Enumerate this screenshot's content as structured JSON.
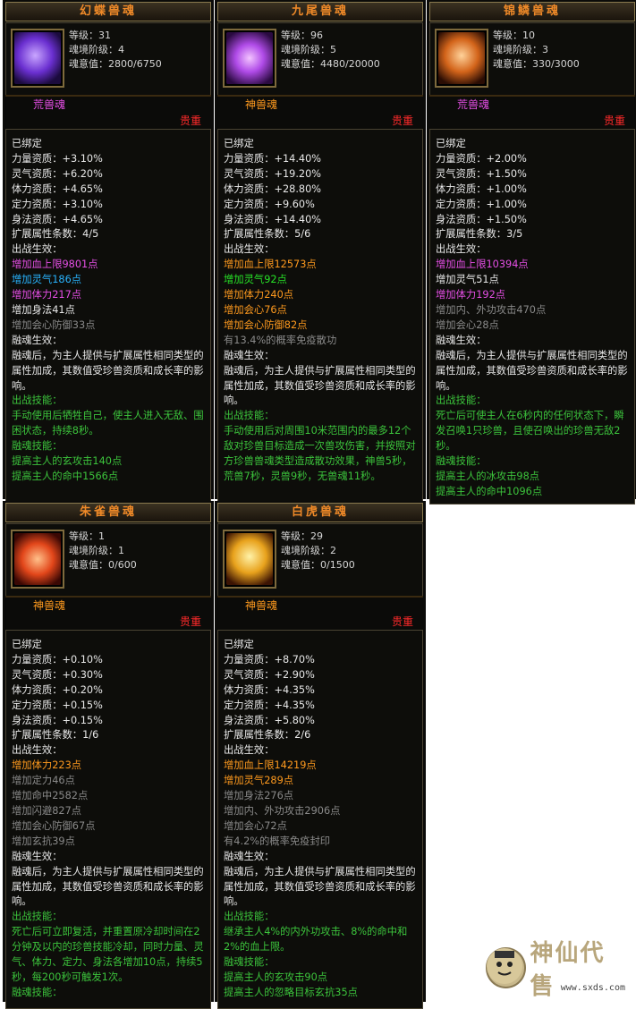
{
  "colors": {
    "title": "#f08a28",
    "rarity": "#ff2a2a",
    "white": "#e8e8e8",
    "gray": "#8a8a8a",
    "green": "#3cc43c",
    "purple": "#e64fe6",
    "cyan": "#29b4ff",
    "orange": "#ff9a1e"
  },
  "cards": [
    {
      "title": "幻蝶兽魂",
      "icon": "butterfly-soul-icon",
      "level": "等级：31",
      "stage": "魂境阶级：4",
      "will": "魂意值：2800/6750",
      "rank": "荒兽魂",
      "rank_color": "#e64fe6",
      "rarity": "贵重",
      "lines": [
        {
          "t": "已绑定",
          "c": "w"
        },
        {
          "t": "力量资质：+3.10%",
          "c": "w"
        },
        {
          "t": "灵气资质：+6.20%",
          "c": "w"
        },
        {
          "t": "体力资质：+4.65%",
          "c": "w"
        },
        {
          "t": "定力资质：+3.10%",
          "c": "w"
        },
        {
          "t": "身法资质：+4.65%",
          "c": "w"
        },
        {
          "t": "扩展属性条数：4/5",
          "c": "w"
        },
        {
          "t": "出战生效：",
          "c": "w"
        },
        {
          "t": "增加血上限9801点",
          "c": "pu"
        },
        {
          "t": "增加灵气186点",
          "c": "cy"
        },
        {
          "t": "增加体力217点",
          "c": "pu"
        },
        {
          "t": "增加身法41点",
          "c": "w"
        },
        {
          "t": "增加会心防御33点",
          "c": "g"
        },
        {
          "t": "融魂生效：",
          "c": "w"
        },
        {
          "t": "融魂后，为主人提供与扩展属性相同类型的属性加成，其数值受珍兽资质和成长率的影响。",
          "c": "w",
          "wrap": true
        },
        {
          "t": "出战技能：",
          "c": "gr"
        },
        {
          "t": "手动使用后牺牲自己，使主人进入无敌、围困状态，持续8秒。",
          "c": "gr",
          "wrap": true
        },
        {
          "t": "融魂技能：",
          "c": "gr"
        },
        {
          "t": "提高主人的玄攻击140点",
          "c": "gr"
        },
        {
          "t": "提高主人的命中1566点",
          "c": "gr"
        }
      ]
    },
    {
      "title": "九尾兽魂",
      "icon": "ninetail-soul-icon",
      "level": "等级：96",
      "stage": "魂境阶级：5",
      "will": "魂意值：4480/20000",
      "rank": "神兽魂",
      "rank_color": "#ff9a1e",
      "rarity": "贵重",
      "lines": [
        {
          "t": "已绑定",
          "c": "w"
        },
        {
          "t": "力量资质：+14.40%",
          "c": "w"
        },
        {
          "t": "灵气资质：+19.20%",
          "c": "w"
        },
        {
          "t": "体力资质：+28.80%",
          "c": "w"
        },
        {
          "t": "定力资质：+9.60%",
          "c": "w"
        },
        {
          "t": "身法资质：+14.40%",
          "c": "w"
        },
        {
          "t": "扩展属性条数：5/6",
          "c": "w"
        },
        {
          "t": "出战生效：",
          "c": "w"
        },
        {
          "t": "增加血上限12573点",
          "c": "or"
        },
        {
          "t": "增加灵气92点",
          "c": "gl"
        },
        {
          "t": "增加体力240点",
          "c": "or"
        },
        {
          "t": "增加会心76点",
          "c": "or"
        },
        {
          "t": "增加会心防御82点",
          "c": "or"
        },
        {
          "t": "有13.4%的概率免疫散功",
          "c": "g"
        },
        {
          "t": "融魂生效：",
          "c": "w"
        },
        {
          "t": "融魂后，为主人提供与扩展属性相同类型的属性加成，其数值受珍兽资质和成长率的影响。",
          "c": "w",
          "wrap": true
        },
        {
          "t": "出战技能：",
          "c": "gr"
        },
        {
          "t": "手动使用后对周围10米范围内的最多12个敌对珍兽目标造成一次兽攻伤害，并按照对方珍兽兽魂类型造成散功效果，神兽5秒，荒兽7秒，灵兽9秒，无兽魂11秒。",
          "c": "gr",
          "wrap": true
        }
      ]
    },
    {
      "title": "锦鳞兽魂",
      "icon": "brocade-scale-soul-icon",
      "level": "等级：10",
      "stage": "魂境阶级：3",
      "will": "魂意值：330/3000",
      "rank": "荒兽魂",
      "rank_color": "#e64fe6",
      "rarity": "贵重",
      "lines": [
        {
          "t": "已绑定",
          "c": "w"
        },
        {
          "t": "力量资质：+2.00%",
          "c": "w"
        },
        {
          "t": "灵气资质：+1.50%",
          "c": "w"
        },
        {
          "t": "体力资质：+1.00%",
          "c": "w"
        },
        {
          "t": "定力资质：+1.00%",
          "c": "w"
        },
        {
          "t": "身法资质：+1.50%",
          "c": "w"
        },
        {
          "t": "扩展属性条数：3/5",
          "c": "w"
        },
        {
          "t": "出战生效：",
          "c": "w"
        },
        {
          "t": "增加血上限10394点",
          "c": "pu"
        },
        {
          "t": "增加灵气51点",
          "c": "w"
        },
        {
          "t": "增加体力192点",
          "c": "pu"
        },
        {
          "t": "增加内、外功攻击470点",
          "c": "g"
        },
        {
          "t": "增加会心28点",
          "c": "g"
        },
        {
          "t": "融魂生效：",
          "c": "w"
        },
        {
          "t": "融魂后，为主人提供与扩展属性相同类型的属性加成，其数值受珍兽资质和成长率的影响。",
          "c": "w",
          "wrap": true
        },
        {
          "t": "出战技能：",
          "c": "gr"
        },
        {
          "t": "死亡后可使主人在6秒内的任何状态下，瞬发召唤1只珍兽，且使召唤出的珍兽无敌2秒。",
          "c": "gr",
          "wrap": true
        },
        {
          "t": "融魂技能：",
          "c": "gr"
        },
        {
          "t": "提高主人的冰攻击98点",
          "c": "gr"
        },
        {
          "t": "提高主人的命中1096点",
          "c": "gr"
        }
      ]
    },
    {
      "title": "朱雀兽魂",
      "icon": "vermilion-bird-soul-icon",
      "level": "等级：1",
      "stage": "魂境阶级：1",
      "will": "魂意值：0/600",
      "rank": "神兽魂",
      "rank_color": "#ff9a1e",
      "rarity": "贵重",
      "lines": [
        {
          "t": "已绑定",
          "c": "w"
        },
        {
          "t": "力量资质：+0.10%",
          "c": "w"
        },
        {
          "t": "灵气资质：+0.30%",
          "c": "w"
        },
        {
          "t": "体力资质：+0.20%",
          "c": "w"
        },
        {
          "t": "定力资质：+0.15%",
          "c": "w"
        },
        {
          "t": "身法资质：+0.15%",
          "c": "w"
        },
        {
          "t": "扩展属性条数：1/6",
          "c": "w"
        },
        {
          "t": "出战生效：",
          "c": "w"
        },
        {
          "t": "增加体力223点",
          "c": "or"
        },
        {
          "t": "增加定力46点",
          "c": "g"
        },
        {
          "t": "增加命中2582点",
          "c": "g"
        },
        {
          "t": "增加闪避827点",
          "c": "g"
        },
        {
          "t": "增加会心防御67点",
          "c": "g"
        },
        {
          "t": "增加玄抗39点",
          "c": "g"
        },
        {
          "t": "融魂生效：",
          "c": "w"
        },
        {
          "t": "融魂后，为主人提供与扩展属性相同类型的属性加成，其数值受珍兽资质和成长率的影响。",
          "c": "w",
          "wrap": true
        },
        {
          "t": "出战技能：",
          "c": "gr"
        },
        {
          "t": "死亡后可立即复活，并重置原冷却时间在2分钟及以内的珍兽技能冷却，同时力量、灵气、体力、定力、身法各增加10点，持续5秒，每200秒可触发1次。",
          "c": "gr",
          "wrap": true
        },
        {
          "t": "融魂技能：",
          "c": "gr"
        }
      ]
    },
    {
      "title": "白虎兽魂",
      "icon": "white-tiger-soul-icon",
      "level": "等级：29",
      "stage": "魂境阶级：2",
      "will": "魂意值：0/1500",
      "rank": "神兽魂",
      "rank_color": "#ff9a1e",
      "rarity": "贵重",
      "lines": [
        {
          "t": "已绑定",
          "c": "w"
        },
        {
          "t": "力量资质：+8.70%",
          "c": "w"
        },
        {
          "t": "灵气资质：+2.90%",
          "c": "w"
        },
        {
          "t": "体力资质：+4.35%",
          "c": "w"
        },
        {
          "t": "定力资质：+4.35%",
          "c": "w"
        },
        {
          "t": "身法资质：+5.80%",
          "c": "w"
        },
        {
          "t": "扩展属性条数：2/6",
          "c": "w"
        },
        {
          "t": "出战生效：",
          "c": "w"
        },
        {
          "t": "增加血上限14219点",
          "c": "or"
        },
        {
          "t": "增加灵气289点",
          "c": "or"
        },
        {
          "t": "增加身法276点",
          "c": "g"
        },
        {
          "t": "增加内、外功攻击2906点",
          "c": "g"
        },
        {
          "t": "增加会心72点",
          "c": "g"
        },
        {
          "t": "有4.2%的概率免疫封印",
          "c": "g"
        },
        {
          "t": "融魂生效：",
          "c": "w"
        },
        {
          "t": "融魂后，为主人提供与扩展属性相同类型的属性加成，其数值受珍兽资质和成长率的影响。",
          "c": "w",
          "wrap": true
        },
        {
          "t": "出战技能：",
          "c": "gr"
        },
        {
          "t": "继承主人4%的内外功攻击、8%的命中和2%的血上限。",
          "c": "gr",
          "wrap": true
        },
        {
          "t": "融魂技能：",
          "c": "gr"
        },
        {
          "t": "提高主人的玄攻击90点",
          "c": "gr"
        },
        {
          "t": "提高主人的忽略目标玄抗35点",
          "c": "gr"
        }
      ]
    }
  ],
  "watermark": {
    "brand": "神仙代售",
    "url": "www.sxds.com"
  }
}
